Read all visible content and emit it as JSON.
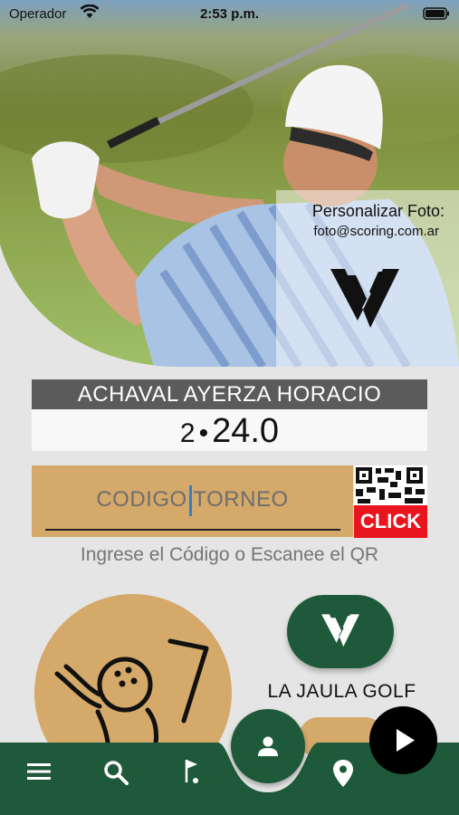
{
  "status_bar": {
    "carrier": "Operador",
    "time": "2:53 p.m."
  },
  "photo": {
    "custom_label": "Personalizar Foto:",
    "custom_email": "foto@scoring.com.ar"
  },
  "player": {
    "name": "ACHAVAL AYERZA HORACIO",
    "handicap_index": "2",
    "handicap_value": "24.0"
  },
  "tournament": {
    "code_placeholder": "CODIGO TORNEO",
    "qr_button": "CLICK",
    "hint": "Ingrese el Código o Escanee el QR"
  },
  "club": {
    "name": "LA JAULA GOLF"
  },
  "nav": {
    "items": [
      "menu-icon",
      "search-icon",
      "golf-flag-icon",
      "profile-icon",
      "location-pin-icon"
    ],
    "play_icon": "play-icon"
  },
  "colors": {
    "green": "#1e5a3a",
    "tan": "#d4a96a",
    "gray_bar": "#5b5b5b",
    "red": "#e8141e"
  }
}
